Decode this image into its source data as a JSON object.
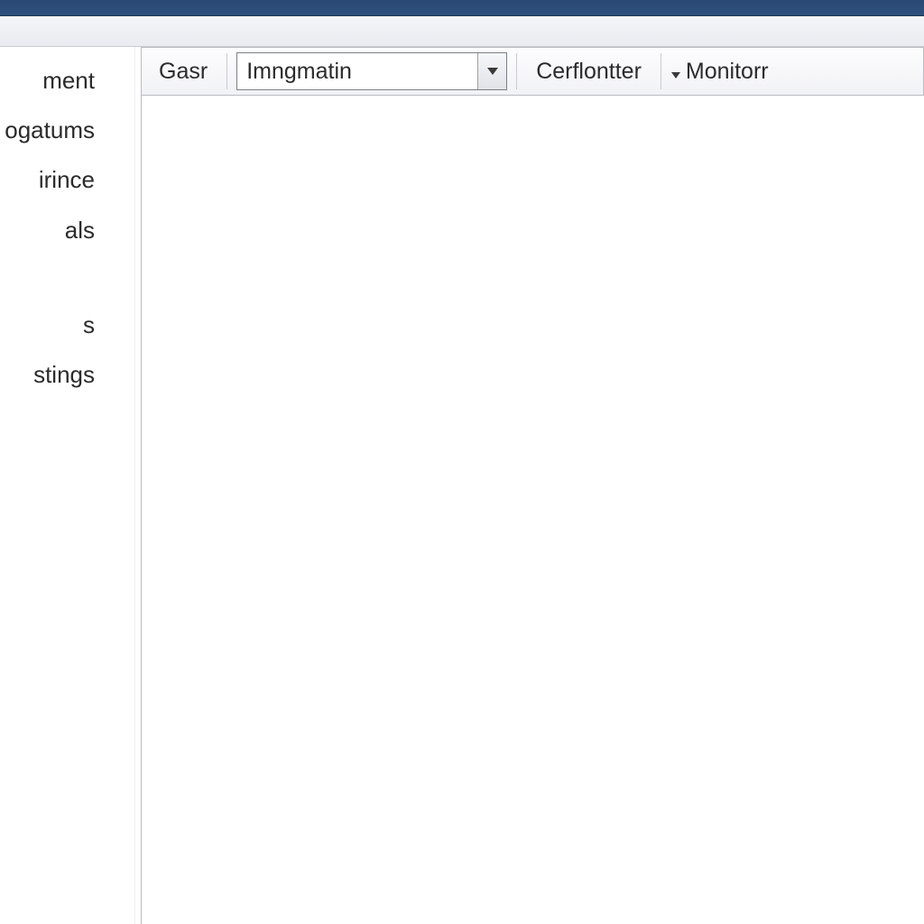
{
  "sidebar": {
    "items": [
      {
        "label": "ment"
      },
      {
        "label": "ogatums"
      },
      {
        "label": "irince"
      },
      {
        "label": "als"
      }
    ],
    "lower_items": [
      {
        "label": "s"
      },
      {
        "label": "stings"
      }
    ]
  },
  "toolbar": {
    "gasr_label": "Gasr",
    "combo_value": "Imngmatin",
    "cerflontter_label": "Cerflontter",
    "monitorr_label": "Monitorr"
  }
}
